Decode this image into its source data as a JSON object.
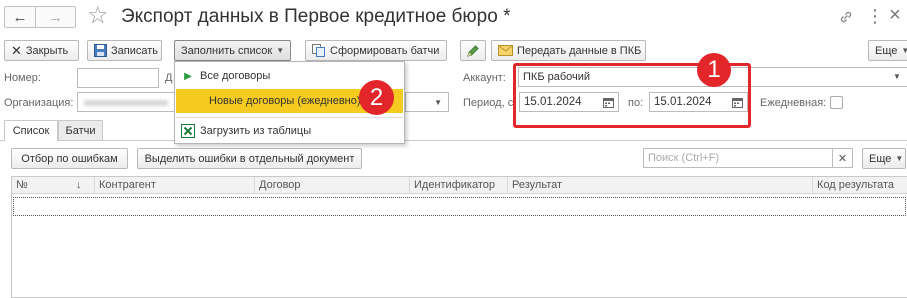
{
  "window": {
    "title": "Экспорт данных в Первое кредитное бюро *",
    "nav": {
      "back": "←",
      "forward": "→",
      "star": "☆"
    },
    "controls": {
      "link": "🔗",
      "more": "⋮",
      "close": "×"
    }
  },
  "toolbar": {
    "close_label": "Закрыть",
    "save_label": "Записать",
    "fill_list_label": "Заполнить список",
    "form_batches_label": "Сформировать батчи",
    "transfer_label": "Передать данные в ПКБ",
    "more_label": "Еще"
  },
  "form": {
    "number_label": "Номер:",
    "number_value": "",
    "date_label_fragment": "Д",
    "org_label": "Организация:",
    "org_value": "",
    "account_label": "Аккаунт:",
    "account_value": "ПКБ рабочий",
    "period_label": "Период, с:",
    "period_from": "15.01.2024",
    "period_to_label": "по:",
    "period_to": "15.01.2024",
    "daily_label": "Ежедневная:"
  },
  "dropdown": {
    "items": [
      {
        "label": "Все договоры",
        "icon": "play-icon"
      },
      {
        "label": "Новые договоры (ежедневно)",
        "icon": "none"
      },
      {
        "label": "Загрузить из таблицы",
        "icon": "excel-icon"
      }
    ]
  },
  "callouts": {
    "one": "1",
    "two": "2"
  },
  "tabs": [
    {
      "label": "Список",
      "active": true
    },
    {
      "label": "Батчи",
      "active": false
    }
  ],
  "list_toolbar": {
    "filter_errors_label": "Отбор по ошибкам",
    "split_errors_label": "Выделить ошибки в отдельный документ",
    "search_placeholder": "Поиск (Ctrl+F)",
    "more_label": "Еще"
  },
  "table": {
    "columns": [
      "№",
      "Контрагент",
      "Договор",
      "Идентификатор",
      "Результат",
      "Код результата"
    ],
    "sort_indicator": "↓"
  },
  "colors": {
    "accent_red": "#e3262a",
    "highlight_yellow": "#f5cb1f",
    "green": "#2a9d3a"
  }
}
